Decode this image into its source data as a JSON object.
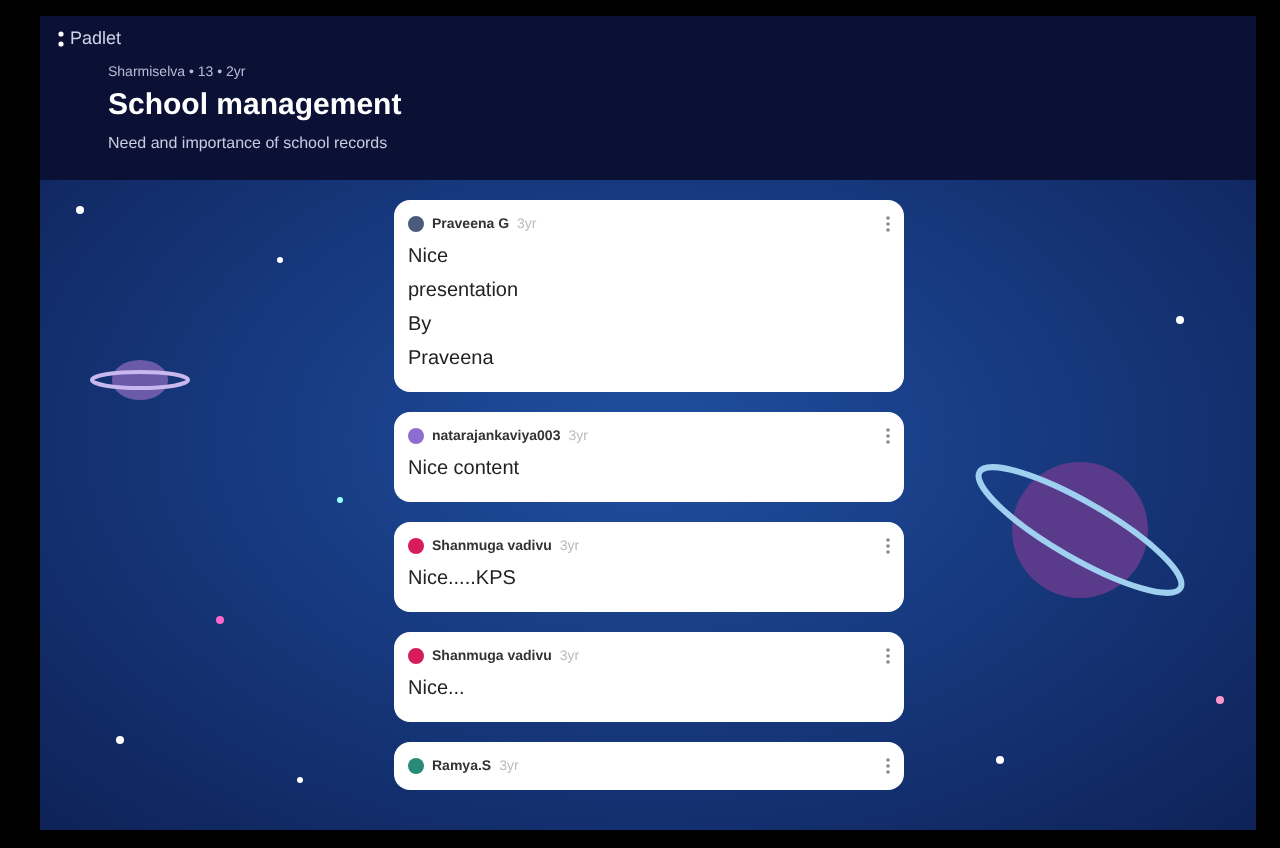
{
  "logo": {
    "text": "Padlet"
  },
  "board": {
    "meta": "Sharmiselva • 13 • 2yr",
    "title": "School management",
    "description": "Need and importance of school records"
  },
  "posts": [
    {
      "author": "Praveena G",
      "time": "3yr",
      "color": "#4a5a7a",
      "body": "Nice\n presentation\nBy\nPraveena"
    },
    {
      "author": "natarajankaviya003",
      "time": "3yr",
      "color": "#8a6fd0",
      "body": "Nice content"
    },
    {
      "author": "Shanmuga vadivu",
      "time": "3yr",
      "color": "#d81b5a",
      "body": "Nice.....KPS"
    },
    {
      "author": "Shanmuga vadivu",
      "time": "3yr",
      "color": "#d81b5a",
      "body": "Nice..."
    },
    {
      "author": "Ramya.S",
      "time": "3yr",
      "color": "#2a8a7a"
    }
  ]
}
